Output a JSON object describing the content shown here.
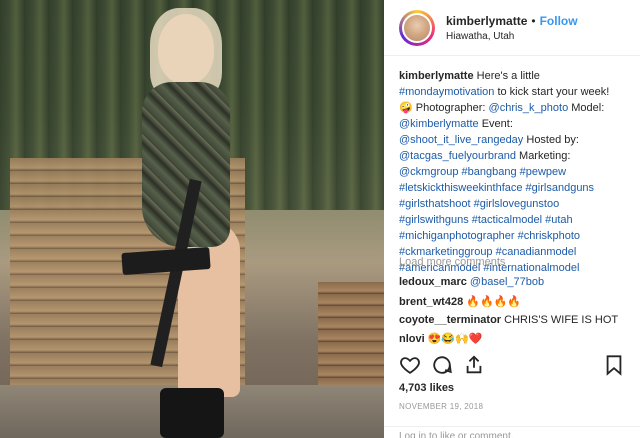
{
  "post": {
    "username": "kimberlymatte",
    "follow_label": "Follow",
    "separator": "•",
    "location": "Hiawatha, Utah"
  },
  "caption": {
    "username": "kimberlymatte",
    "lines": [
      [
        {
          "t": "Here's a little ",
          "k": "text"
        }
      ],
      [
        {
          "t": "#mondaymotivation",
          "k": "link"
        },
        {
          "t": " to kick start your week!",
          "k": "text"
        }
      ],
      [
        {
          "t": "🤪 Photographer: ",
          "k": "text"
        },
        {
          "t": "@chris_k_photo",
          "k": "link"
        },
        {
          "t": " Model:",
          "k": "text"
        }
      ],
      [
        {
          "t": "@kimberlymatte",
          "k": "link"
        },
        {
          "t": " Event:",
          "k": "text"
        }
      ],
      [
        {
          "t": "@shoot_it_live_rangeday",
          "k": "link"
        },
        {
          "t": " Hosted by:",
          "k": "text"
        }
      ],
      [
        {
          "t": "@tacgas_fuelyourbrand",
          "k": "link"
        },
        {
          "t": " Marketing:",
          "k": "text"
        }
      ],
      [
        {
          "t": "@ckmgroup #bangbang #pewpew",
          "k": "link"
        }
      ],
      [
        {
          "t": "#letskickthisweekinthface #girlsandguns",
          "k": "link"
        }
      ],
      [
        {
          "t": "#girlsthatshoot #girlslovegunstoo",
          "k": "link"
        }
      ],
      [
        {
          "t": "#girlswithguns #tacticalmodel #utah",
          "k": "link"
        }
      ],
      [
        {
          "t": "#michiganphotographer #chriskphoto",
          "k": "link"
        }
      ],
      [
        {
          "t": "#ckmarketinggroup #canadianmodel",
          "k": "link"
        }
      ],
      [
        {
          "t": "#americanmodel #internationalmodel",
          "k": "link"
        }
      ]
    ]
  },
  "load_more_label": "Load more comments",
  "comments": [
    {
      "user": "ledoux_marc",
      "text": "@basel_77bob",
      "kind": "link"
    },
    {
      "user": "brent_wt428",
      "text": "🔥🔥🔥🔥",
      "kind": "text"
    },
    {
      "user": "coyote__terminator",
      "text": "CHRIS'S WIFE IS HOT",
      "kind": "text"
    },
    {
      "user": "nlovi",
      "text": "😍😂🙌❤️",
      "kind": "text"
    }
  ],
  "actions": {
    "like_icon": "heart-icon",
    "comment_icon": "comment-icon",
    "share_icon": "share-icon",
    "save_icon": "bookmark-icon"
  },
  "likes_text": "4,703 likes",
  "date_text": "NOVEMBER 19, 2018",
  "add_comment_placeholder": "Log in to like or comment."
}
